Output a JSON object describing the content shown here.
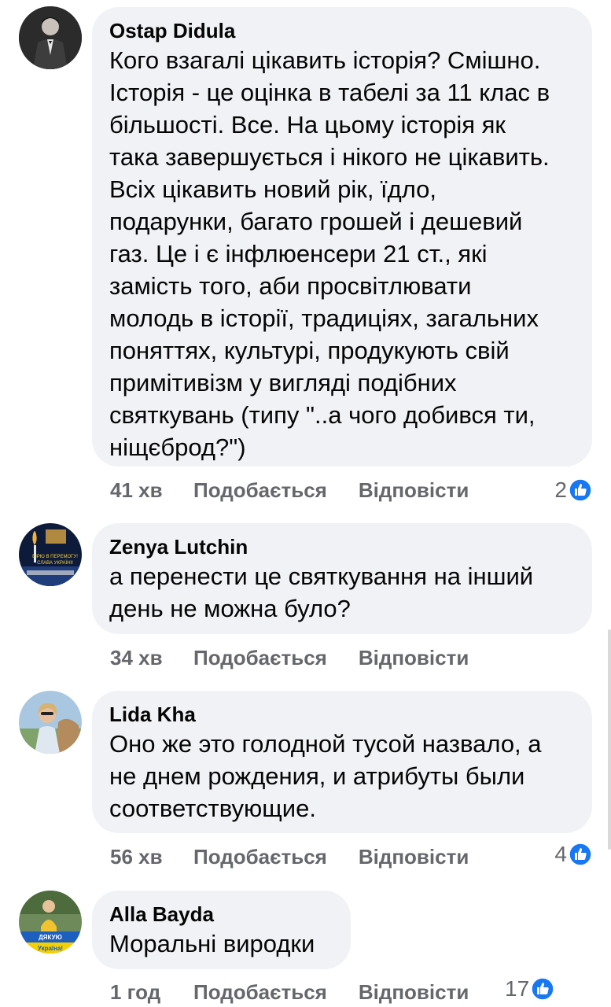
{
  "comments": [
    {
      "author": "Ostap Didula",
      "lines": [
        "Кого взагалі цікавить історія? Смішно.",
        "Історія - це оцінка в табелі за 11 клас в",
        "більшості. Все. На цьому історія як",
        "така завершується і нікого не цікавить.",
        "Всіх цікавить новий рік, їдло,",
        "подарунки, багато грошей і дешевий",
        "газ. Це і є інфлюенсери 21 ст., які",
        "замість того, аби просвітлювати",
        "молодь в історії, традиціях, загальних",
        "поняттях, культурі, продукують свій",
        "примітивізм у вигляді подібних",
        "святкувань (типу \"..а чого добився ти,",
        "ніщєброд?\")"
      ],
      "time": "41 хв",
      "like_label": "Подобається",
      "reply_label": "Відповісти",
      "reactions": "2"
    },
    {
      "author": "Zenya  Lutchin",
      "lines": [
        "а перенести це святкування на інший",
        "день не можна було?"
      ],
      "time": "34 хв",
      "like_label": "Подобається",
      "reply_label": "Відповісти",
      "reactions": ""
    },
    {
      "author": "Lida Kha",
      "lines": [
        "Оно же это голодной тусой назвало, а",
        "не днем рождения, и атрибуты были",
        "соответствующие."
      ],
      "time": "56 хв",
      "like_label": "Подобається",
      "reply_label": "Відповісти",
      "reactions": "4"
    },
    {
      "author": "Alla  Bayda",
      "lines": [
        "Моральні виродки"
      ],
      "time": "1 год",
      "like_label": "Подобається",
      "reply_label": "Відповісти",
      "reactions": "17"
    }
  ],
  "avatar_texts": {
    "zenya": [
      "ВІРЮ В ПЕРЕМОГУ!",
      "СЛАВА УКРАЇНІ!"
    ],
    "alla": [
      "ДЯКУЮ",
      "Україна!"
    ]
  },
  "colors": {
    "bubble": "#f0f2f5",
    "meta_text": "#65676b",
    "like_blue": "#1877f2"
  },
  "icons": [
    "like-icon"
  ]
}
